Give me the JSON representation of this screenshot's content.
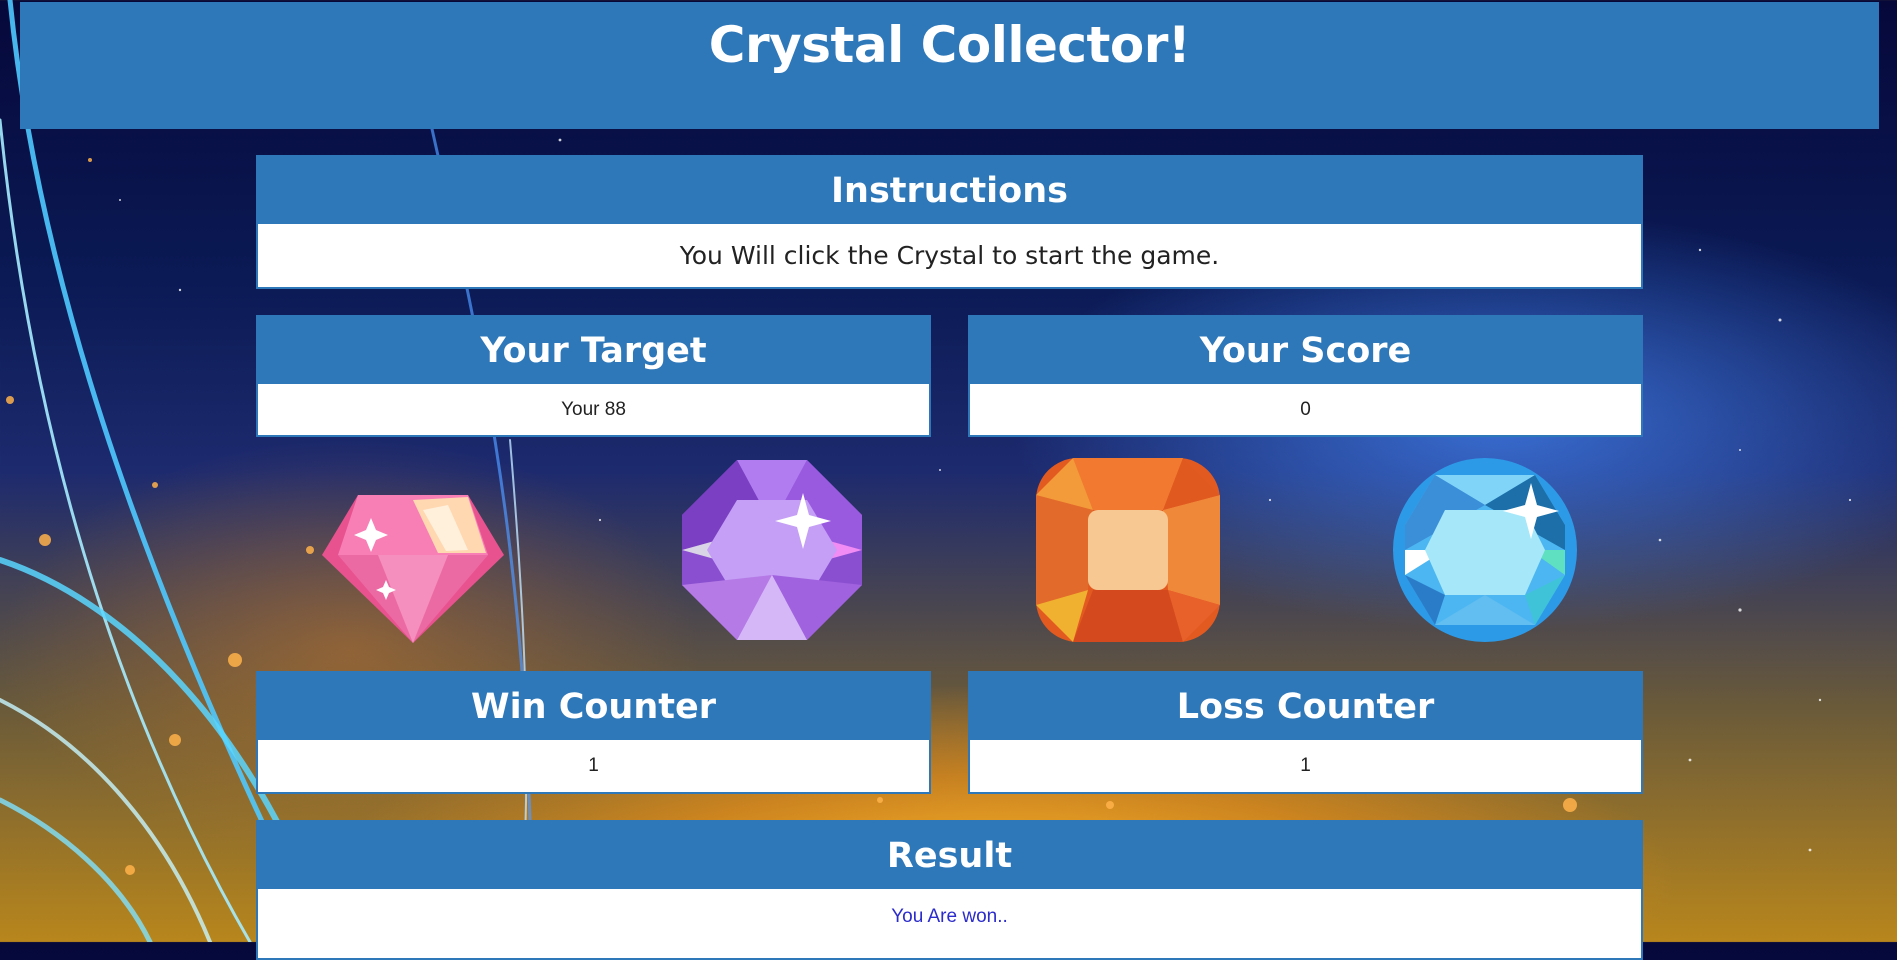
{
  "header": {
    "title": "Crystal Collector!"
  },
  "instructions": {
    "heading": "Instructions",
    "text": "You Will click the Crystal to start the game."
  },
  "target": {
    "heading": "Your Target",
    "value": "Your 88"
  },
  "score": {
    "heading": "Your Score",
    "value": "0"
  },
  "crystals": [
    {
      "name": "pink-diamond",
      "color": "#f06aa8"
    },
    {
      "name": "purple-gem",
      "color": "#a466e0"
    },
    {
      "name": "orange-gem",
      "color": "#f08a2a"
    },
    {
      "name": "blue-gem",
      "color": "#3aaaf0"
    }
  ],
  "wins": {
    "heading": "Win Counter",
    "value": "1"
  },
  "losses": {
    "heading": "Loss Counter",
    "value": "1"
  },
  "result": {
    "heading": "Result",
    "text": "You Are won.."
  },
  "colors": {
    "panel_blue": "#2e78ba",
    "result_text": "#2c2ccc"
  }
}
